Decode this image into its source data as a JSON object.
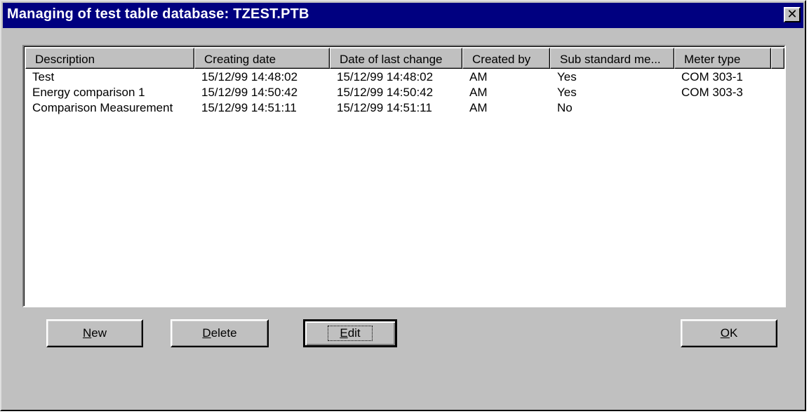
{
  "window": {
    "title": "Managing of test table database: TZEST.PTB",
    "close_glyph": "✕"
  },
  "table": {
    "columns": [
      "Description",
      "Creating date",
      "Date of last change",
      "Created by",
      "Sub standard me...",
      "Meter type"
    ],
    "rows": [
      {
        "description": "Test",
        "creating_date": "15/12/99 14:48:02",
        "last_change": "15/12/99 14:48:02",
        "created_by": "AM",
        "sub_standard": "Yes",
        "meter_type": "COM 303-1"
      },
      {
        "description": "Energy comparison 1",
        "creating_date": "15/12/99 14:50:42",
        "last_change": "15/12/99 14:50:42",
        "created_by": "AM",
        "sub_standard": "Yes",
        "meter_type": "COM 303-3"
      },
      {
        "description": "Comparison Measurement",
        "creating_date": "15/12/99 14:51:11",
        "last_change": "15/12/99 14:51:11",
        "created_by": "AM",
        "sub_standard": "No",
        "meter_type": ""
      }
    ]
  },
  "buttons": {
    "new": {
      "mnemonic": "N",
      "rest": "ew"
    },
    "delete": {
      "mnemonic": "D",
      "rest": "elete"
    },
    "edit": {
      "mnemonic": "E",
      "rest": "dit"
    },
    "ok": {
      "mnemonic": "O",
      "rest": "K"
    }
  }
}
